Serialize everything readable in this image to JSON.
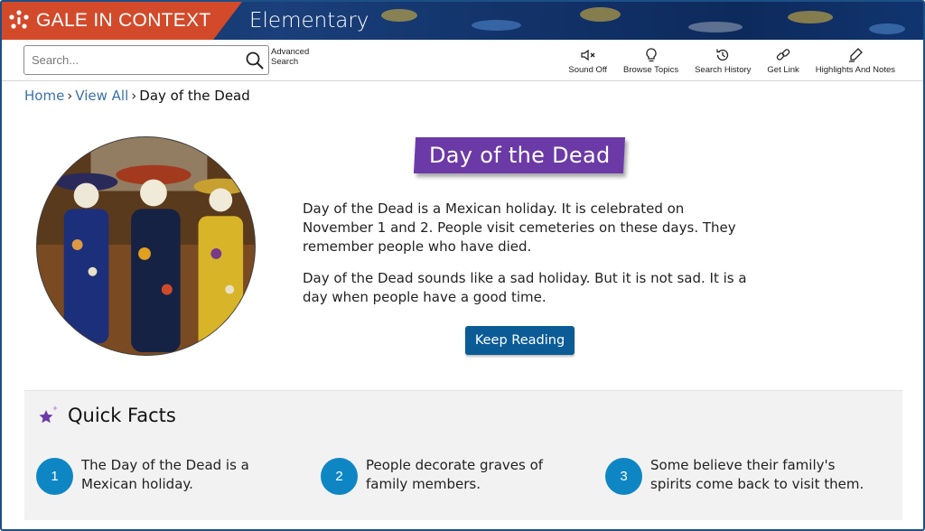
{
  "header": {
    "brand": "GALE IN CONTEXT",
    "edition": "Elementary",
    "brand_color": "#d34a2a"
  },
  "search": {
    "placeholder": "Search...",
    "advanced_label_line1": "Advanced",
    "advanced_label_line2": "Search"
  },
  "tools": [
    {
      "label": "Sound Off",
      "icon": "speaker-muted-icon"
    },
    {
      "label": "Browse Topics",
      "icon": "lightbulb-icon"
    },
    {
      "label": "Search History",
      "icon": "history-icon"
    },
    {
      "label": "Get Link",
      "icon": "link-icon"
    },
    {
      "label": "Highlights And Notes",
      "icon": "highlighter-icon"
    }
  ],
  "breadcrumb": {
    "home": "Home",
    "view_all": "View All",
    "current": "Day of the Dead"
  },
  "article": {
    "title": "Day of the Dead",
    "title_color": "#6c3aa7",
    "paragraphs": [
      "Day of the Dead is a Mexican holiday. It is celebrated on November 1 and 2. People visit cemeteries on these days. They remember people who have died.",
      "Day of the Dead sounds like a sad holiday. But it is not sad. It is a day when people have a good time."
    ],
    "keep_reading": "Keep Reading",
    "button_color": "#0b5c96"
  },
  "quick_facts": {
    "heading": "Quick Facts",
    "items": [
      {
        "num": "1",
        "text": "The Day of the Dead is a Mexican holiday."
      },
      {
        "num": "2",
        "text": "People decorate graves of family members."
      },
      {
        "num": "3",
        "text": "Some believe their family's spirits come back to visit them."
      }
    ],
    "badge_color": "#0f86c4"
  }
}
